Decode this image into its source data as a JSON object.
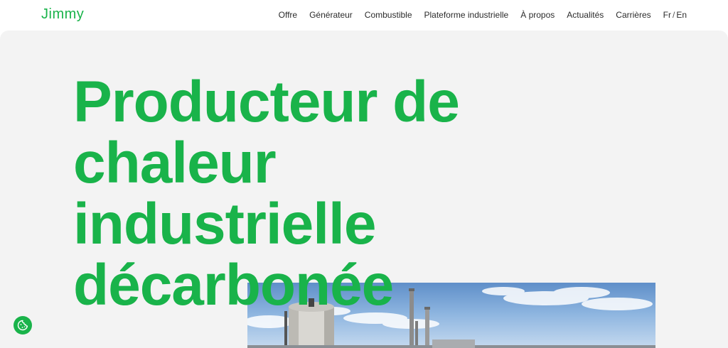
{
  "header": {
    "logo": "Jimmy",
    "nav": [
      {
        "label": "Offre"
      },
      {
        "label": "Générateur"
      },
      {
        "label": "Combustible"
      },
      {
        "label": "Plateforme industrielle"
      },
      {
        "label": "À propos"
      },
      {
        "label": "Actualités"
      },
      {
        "label": "Carrières"
      }
    ],
    "lang": {
      "fr": "Fr",
      "separator": "/",
      "en": "En"
    }
  },
  "hero": {
    "headline_lines": [
      "Producteur de",
      "chaleur",
      "industrielle",
      "décarbonée"
    ]
  },
  "colors": {
    "brand_green": "#19b34a",
    "hero_bg": "#f3f3f3"
  },
  "icons": {
    "cookie": "cookie-icon"
  }
}
